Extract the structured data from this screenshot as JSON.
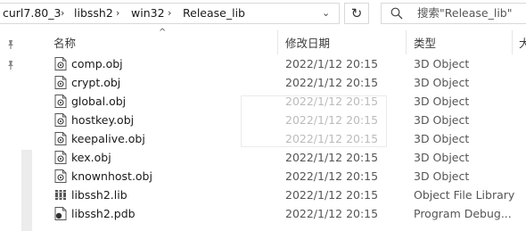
{
  "address_bar": {
    "segments": [
      "curl7.80_3",
      "libssh2",
      "win32",
      "Release_lib"
    ],
    "separator": "›",
    "dropdown_icon": "chevron-down-icon"
  },
  "refresh_icon": "refresh-icon",
  "search": {
    "placeholder": "搜索\"Release_lib\""
  },
  "columns": {
    "name": "名称",
    "modified": "修改日期",
    "type": "类型",
    "size": "大"
  },
  "files": [
    {
      "name": "comp.obj",
      "modified": "2022/1/12 20:15",
      "type": "3D Object",
      "icon": "3d-object-file-icon"
    },
    {
      "name": "crypt.obj",
      "modified": "2022/1/12 20:15",
      "type": "3D Object",
      "icon": "3d-object-file-icon"
    },
    {
      "name": "global.obj",
      "modified": "2022/1/12 20:15",
      "type": "3D Object",
      "icon": "3d-object-file-icon"
    },
    {
      "name": "hostkey.obj",
      "modified": "2022/1/12 20:15",
      "type": "3D Object",
      "icon": "3d-object-file-icon"
    },
    {
      "name": "keepalive.obj",
      "modified": "2022/1/12 20:15",
      "type": "3D Object",
      "icon": "3d-object-file-icon"
    },
    {
      "name": "kex.obj",
      "modified": "2022/1/12 20:15",
      "type": "3D Object",
      "icon": "3d-object-file-icon"
    },
    {
      "name": "knownhost.obj",
      "modified": "2022/1/12 20:15",
      "type": "3D Object",
      "icon": "3d-object-file-icon"
    },
    {
      "name": "libssh2.lib",
      "modified": "2022/1/12 20:15",
      "type": "Object File Library",
      "icon": "library-file-icon"
    },
    {
      "name": "libssh2.pdb",
      "modified": "2022/1/12 20:15",
      "type": "Program Debug...",
      "icon": "debug-file-icon"
    }
  ],
  "colors": {
    "border": "#d9d9d9",
    "header_text": "#3a3a3a",
    "secondary_text": "#555555",
    "scroll_track": "#ececec"
  }
}
